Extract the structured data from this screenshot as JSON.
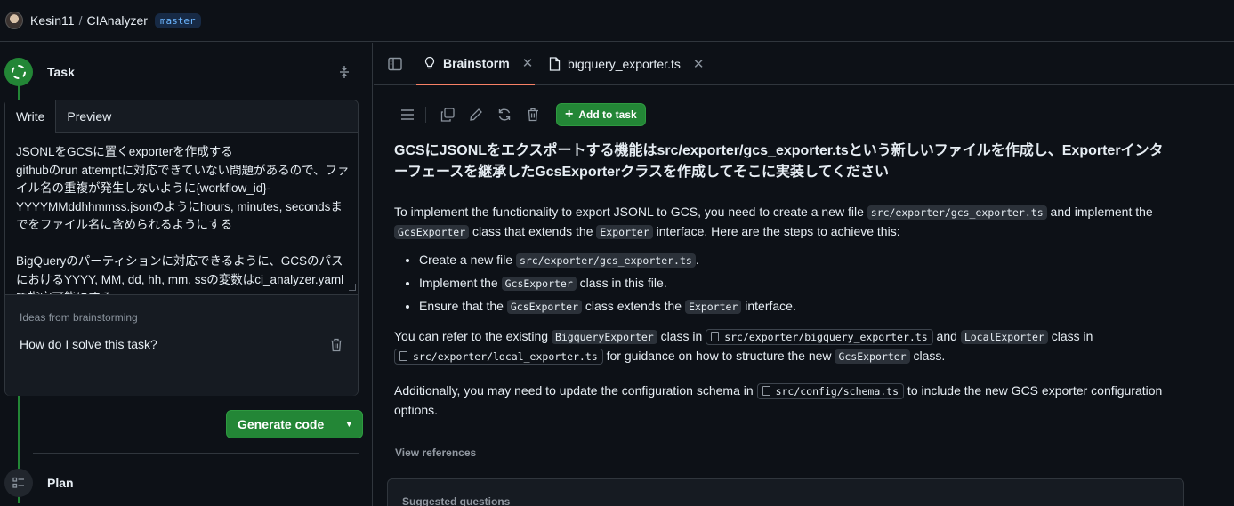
{
  "header": {
    "owner": "Kesin11",
    "separator": "/",
    "repo": "CIAnalyzer",
    "branch": "master"
  },
  "task": {
    "title": "Task",
    "tabs": {
      "write": "Write",
      "preview": "Preview"
    },
    "text": "JSONLをGCSに置くexporterを作成する\ngithubのrun attemptに対応できていない問題があるので、ファイル名の重複が発生しないように{workflow_id}-YYYYMMddhhmmss.jsonのようにhours, minutes, secondsまでをファイル名に含められるようにする\n\nBigQueryのパーティションに対応できるように、GCSのパスにおけるYYYY, MM, dd, hh, mm, ssの変数はci_analyzer.yamlで指定可能にする",
    "ideas_heading": "Ideas from brainstorming",
    "ideas_question": "How do I solve this task?",
    "generate_label": "Generate code"
  },
  "plan": {
    "title": "Plan"
  },
  "tabs": [
    {
      "label": "Brainstorm"
    },
    {
      "label": "bigquery_exporter.ts"
    }
  ],
  "toolbar": {
    "add_label": "Add to task"
  },
  "content": {
    "heading": "GCSにJSONLをエクスポートする機能はsrc/exporter/gcs_exporter.tsという新しいファイルを作成し、Exporterインターフェースを継承したGcsExporterクラスを作成してそこに実装してください",
    "p1": {
      "t1": "To implement the functionality to export JSONL to GCS, you need to create a new file ",
      "c1": "src/exporter/gcs_exporter.ts",
      "t2": " and implement the ",
      "c2": "GcsExporter",
      "t3": " class that extends the ",
      "c3": "Exporter",
      "t4": " interface. Here are the steps to achieve this:"
    },
    "steps": [
      {
        "t1": "Create a new file ",
        "c1": "src/exporter/gcs_exporter.ts",
        "t2": "."
      },
      {
        "t1": "Implement the ",
        "c1": "GcsExporter",
        "t2": " class in this file."
      },
      {
        "t1": "Ensure that the ",
        "c1": "GcsExporter",
        "t2": " class extends the ",
        "c2": "Exporter",
        "t3": " interface."
      }
    ],
    "p2": {
      "t1": "You can refer to the existing ",
      "c1": "BigqueryExporter",
      "t2": " class in ",
      "f1": "src/exporter/bigquery_exporter.ts",
      "t3": " and ",
      "c2": "LocalExporter",
      "t4": " class in ",
      "f2": "src/exporter/local_exporter.ts",
      "t5": " for guidance on how to structure the new ",
      "c3": "GcsExporter",
      "t6": " class."
    },
    "p3": {
      "t1": "Additionally, you may need to update the configuration schema in ",
      "f1": "src/config/schema.ts",
      "t2": " to include the new GCS exporter configuration options."
    },
    "view_references": "View references",
    "suggested_questions": "Suggested questions"
  }
}
